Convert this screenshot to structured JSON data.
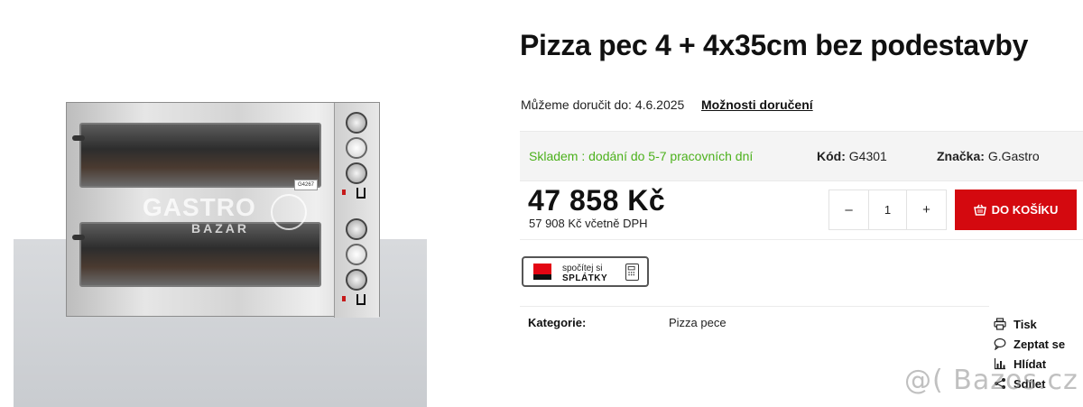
{
  "product": {
    "title": "Pizza pec 4 + 4x35cm bez podestavby",
    "image_tag": "G4267",
    "watermark_line1": "GASTRO",
    "watermark_line2": "BAZAR"
  },
  "delivery": {
    "text": "Můžeme doručit do: 4.6.2025",
    "link_label": "Možnosti doručení"
  },
  "info": {
    "stock": "Skladem : dodání do 5-7 pracovních dní",
    "code_label": "Kód:",
    "code_value": "G4301",
    "brand_label": "Značka:",
    "brand_value": "G.Gastro"
  },
  "pricing": {
    "price": "47 858 Kč",
    "price_vat": "57 908 Kč včetně DPH"
  },
  "cart": {
    "minus": "–",
    "quantity": "1",
    "plus": "+",
    "add_label": "DO KOŠÍKU"
  },
  "installments": {
    "line1": "spočítej si",
    "line2": "SPLÁTKY"
  },
  "category": {
    "label": "Kategorie:",
    "value": "Pizza pece"
  },
  "actions": [
    {
      "label": "Tisk",
      "icon": "printer-icon"
    },
    {
      "label": "Zeptat se",
      "icon": "chat-icon"
    },
    {
      "label": "Hlídat",
      "icon": "chart-icon"
    },
    {
      "label": "Sdílet",
      "icon": "share-icon"
    }
  ],
  "site_watermark": "@( Bazos.cz",
  "colors": {
    "accent_red": "#d4090f",
    "stock_green": "#4cb11c"
  }
}
